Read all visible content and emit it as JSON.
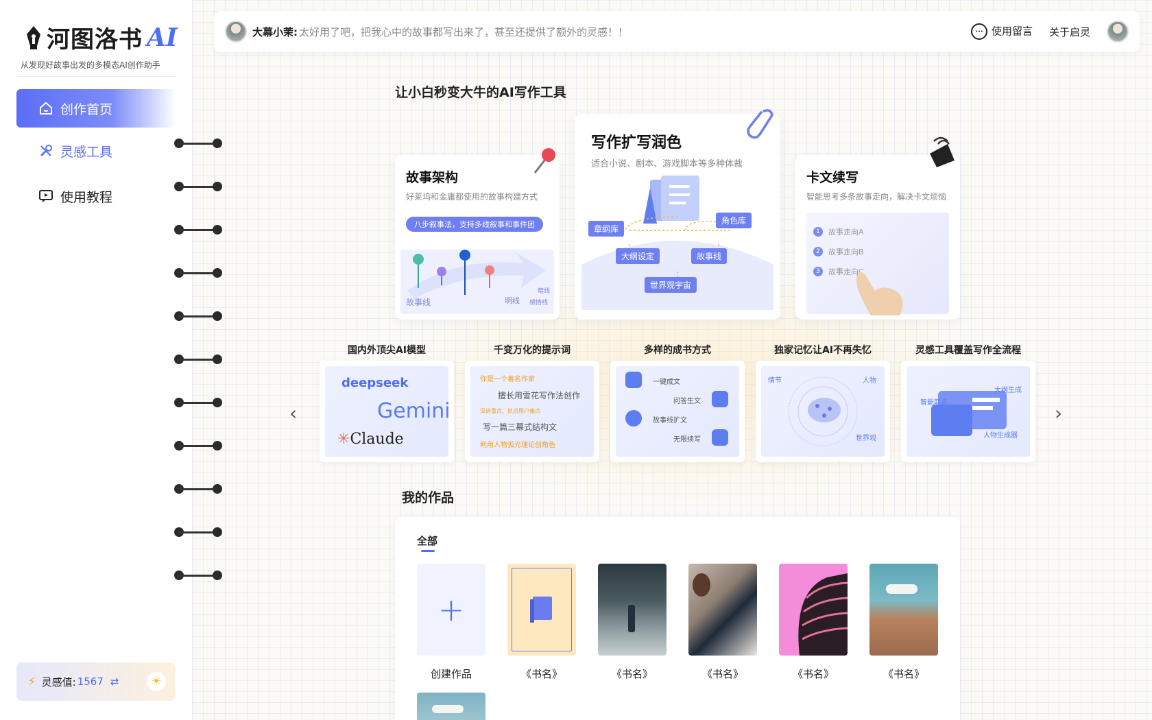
{
  "app": {
    "name": "河图洛书",
    "name_suffix": "AI",
    "tagline": "从发现好故事出发的多模态AI创作助手"
  },
  "sidebar": {
    "items": [
      {
        "label": "创作首页",
        "icon": "home-icon",
        "active": true
      },
      {
        "label": "灵感工具",
        "icon": "tools-icon",
        "active": false
      },
      {
        "label": "使用教程",
        "icon": "tutorial-icon",
        "active": false
      }
    ],
    "inspiration": {
      "label": "灵感值:",
      "value": "1567"
    }
  },
  "topbar": {
    "user": "大幕小茉:",
    "message": "太好用了吧，把我心中的故事都写出来了，甚至还提供了额外的灵感！！",
    "feedback": "使用留言",
    "about": "关于启灵"
  },
  "hero": {
    "title": "让小白秒变大牛的AI写作工具",
    "cards": [
      {
        "title": "故事架构",
        "subtitle": "好莱坞和金庸都使用的故事构建方式",
        "pill": "八步叙事法，支持多线叙事和事件团",
        "labels": [
          "故事线",
          "明线",
          "暗线",
          "感情线"
        ]
      },
      {
        "title": "写作扩写润色",
        "subtitle": "适合小说、剧本、游戏脚本等多种体裁",
        "tags": [
          "章纲库",
          "角色库",
          "大纲设定",
          "故事线",
          "世界观宇宙"
        ]
      },
      {
        "title": "卡文续写",
        "subtitle": "智能思考多条故事走向，解决卡文烦恼",
        "options": [
          "故事走向A",
          "故事走向B",
          "故事走向C"
        ]
      }
    ]
  },
  "features": [
    {
      "title": "国内外顶尖AI模型",
      "items": [
        "deepseek",
        "Gemini",
        "Claude"
      ]
    },
    {
      "title": "千变万化的提示词",
      "items": [
        "你是一个著名作家",
        "擅长用雪花写作法创作",
        "深谙重点、抓点用户痛点",
        "写一篇三幕式结构文",
        "利用人物弧光理论创角色"
      ]
    },
    {
      "title": "多样的成书方式",
      "items": [
        "一键成文",
        "问答生文",
        "故事线扩文",
        "无限续写"
      ]
    },
    {
      "title": "独家记忆让AI不再失忆",
      "items": [
        "情节",
        "人物",
        "世界观"
      ]
    },
    {
      "title": "灵感工具覆盖写作全流程",
      "items": [
        "智能取名",
        "大纲生成",
        "人物生成器"
      ]
    }
  ],
  "works": {
    "title": "我的作品",
    "tab": "全部",
    "create_label": "创建作品",
    "items": [
      "《书名》",
      "《书名》",
      "《书名》",
      "《书名》",
      "《书名》"
    ]
  },
  "colors": {
    "accent": "#4f6ef7",
    "pill": "#6f7ef0",
    "warm": "#fde2aa"
  }
}
